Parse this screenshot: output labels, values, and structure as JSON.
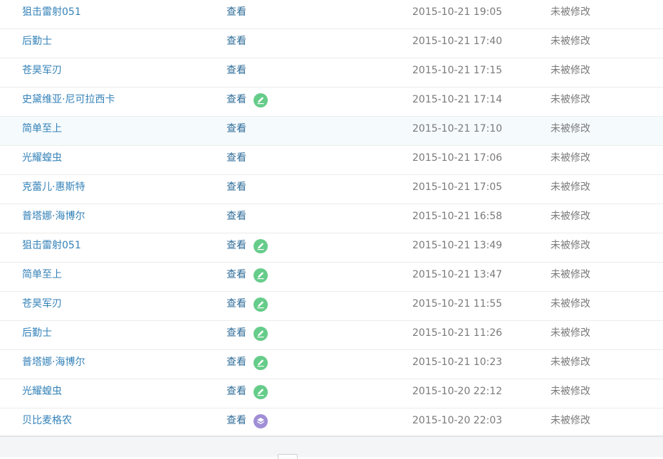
{
  "rows": [
    {
      "name": "狙击雷射051",
      "view": "查看",
      "time": "2015-10-21 19:05",
      "status": "未被修改",
      "icon": ""
    },
    {
      "name": "后勤士",
      "view": "查看",
      "time": "2015-10-21 17:40",
      "status": "未被修改",
      "icon": ""
    },
    {
      "name": "苍昊军刃",
      "view": "查看",
      "time": "2015-10-21 17:15",
      "status": "未被修改",
      "icon": ""
    },
    {
      "name": "史黛维亚·尼可拉西卡",
      "view": "查看",
      "time": "2015-10-21 17:14",
      "status": "未被修改",
      "icon": "edit-icon"
    },
    {
      "name": "简单至上",
      "view": "查看",
      "time": "2015-10-21 17:10",
      "status": "未被修改",
      "icon": ""
    },
    {
      "name": "光耀蝗虫",
      "view": "查看",
      "time": "2015-10-21 17:06",
      "status": "未被修改",
      "icon": ""
    },
    {
      "name": "克蕾儿·惠斯特",
      "view": "查看",
      "time": "2015-10-21 17:05",
      "status": "未被修改",
      "icon": ""
    },
    {
      "name": "普塔娜·海博尔",
      "view": "查看",
      "time": "2015-10-21 16:58",
      "status": "未被修改",
      "icon": ""
    },
    {
      "name": "狙击雷射051",
      "view": "查看",
      "time": "2015-10-21 13:49",
      "status": "未被修改",
      "icon": "edit-icon"
    },
    {
      "name": "简单至上",
      "view": "查看",
      "time": "2015-10-21 13:47",
      "status": "未被修改",
      "icon": "edit-icon"
    },
    {
      "name": "苍昊军刃",
      "view": "查看",
      "time": "2015-10-21 11:55",
      "status": "未被修改",
      "icon": "edit-icon"
    },
    {
      "name": "后勤士",
      "view": "查看",
      "time": "2015-10-21 11:26",
      "status": "未被修改",
      "icon": "edit-icon"
    },
    {
      "name": "普塔娜·海博尔",
      "view": "查看",
      "time": "2015-10-21 10:23",
      "status": "未被修改",
      "icon": "edit-icon"
    },
    {
      "name": "光耀蝗虫",
      "view": "查看",
      "time": "2015-10-20 22:12",
      "status": "未被修改",
      "icon": "edit-icon"
    },
    {
      "name": "贝比麦格农",
      "view": "查看",
      "time": "2015-10-20 22:03",
      "status": "未被修改",
      "icon": "layers-icon"
    }
  ],
  "highlighted_row": 4,
  "colors": {
    "link": "#3482b8",
    "edit_badge": "#66cc8a",
    "layers_badge": "#a08fd6",
    "meta_text": "#7a7a7a"
  }
}
